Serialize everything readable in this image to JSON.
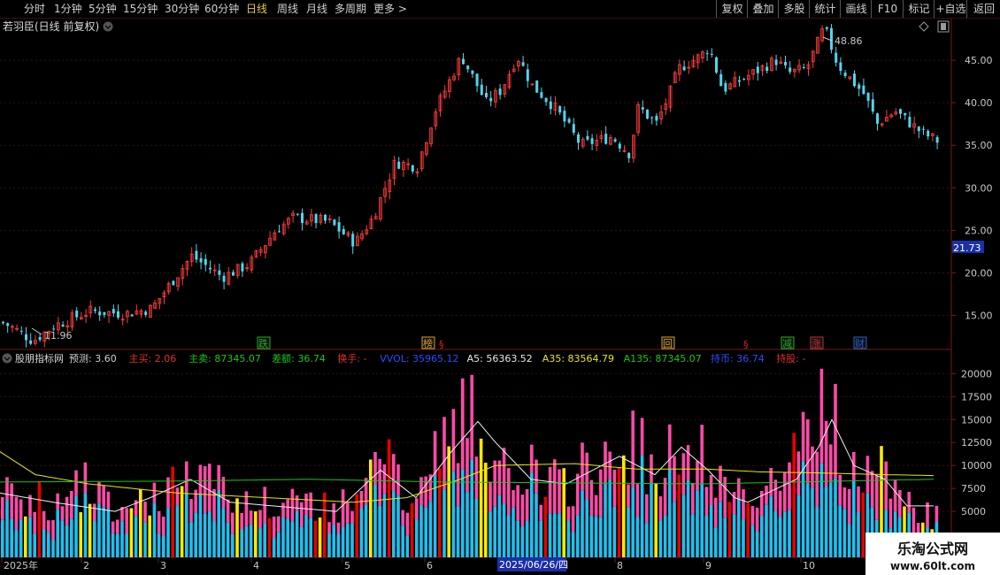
{
  "toolbar": {
    "periods": [
      "分时",
      "1分钟",
      "5分钟",
      "15分钟",
      "30分钟",
      "60分钟",
      "日线",
      "周线",
      "月线",
      "多周期",
      "更多 >"
    ],
    "active_period": "日线",
    "right_buttons": [
      "复权",
      "叠加",
      "多股",
      "统计",
      "画线",
      "F10",
      "标记",
      "+自选",
      "返回"
    ]
  },
  "main": {
    "title": "若羽臣(日线 前复权)",
    "high_label": "48.86",
    "low_label": "11.96",
    "current_price": "21.73",
    "y_ticks": [
      "45.00",
      "40.00",
      "35.00",
      "30.00",
      "25.00",
      "20.00",
      "15.00"
    ],
    "events": [
      {
        "label": "跌",
        "color": "#1db11d"
      },
      {
        "label": "榜",
        "color": "#d8a020"
      },
      {
        "label": "§",
        "color": "#e02020"
      },
      {
        "label": "回",
        "color": "#d8a020"
      },
      {
        "label": "§",
        "color": "#e02020"
      },
      {
        "label": "§",
        "color": "#e02020"
      },
      {
        "label": "减",
        "color": "#1db11d"
      },
      {
        "label": "涨",
        "color": "#c03030"
      },
      {
        "label": "财",
        "color": "#2060d0"
      }
    ]
  },
  "indicator": {
    "name": "股朋指标网",
    "fields": [
      {
        "text": "预测: 3.60",
        "color": "#d0d0d0"
      },
      {
        "text": "主买: 2.06",
        "color": "#e03030"
      },
      {
        "text": "主卖: 87345.07",
        "color": "#18c818"
      },
      {
        "text": "差额: 36.74",
        "color": "#18c818"
      },
      {
        "text": "换手: -",
        "color": "#e03030"
      },
      {
        "text": "VVOL: 35965.12",
        "color": "#2a4cff"
      },
      {
        "text": "A5: 56363.52",
        "color": "#e8e8e8"
      },
      {
        "text": "A35: 83564.79",
        "color": "#e8e800"
      },
      {
        "text": "A135: 87345.07",
        "color": "#18c818"
      },
      {
        "text": "持币: 36.74",
        "color": "#2a4cff"
      },
      {
        "text": "持股: -",
        "color": "#e03030"
      }
    ],
    "y_ticks": [
      "20000",
      "17500",
      "15000",
      "12500",
      "10000",
      "7500",
      "5000"
    ]
  },
  "xaxis": {
    "labels": [
      "2025年",
      "2",
      "3",
      "4",
      "5",
      "6",
      "7",
      "8",
      "9",
      "10"
    ],
    "cursor_date": "2025/06/26/四"
  },
  "watermark": {
    "line1": "乐淘公式网",
    "line2": "www.60lt.com"
  },
  "chart_data": {
    "type": "candlestick",
    "price_range": [
      11,
      50
    ],
    "volume_range": [
      0,
      21000
    ],
    "price_path": [
      [
        0,
        14.2
      ],
      [
        14,
        13.5
      ],
      [
        36,
        12.0
      ],
      [
        60,
        13.8
      ],
      [
        100,
        15.5
      ],
      [
        140,
        15.2
      ],
      [
        170,
        15.8
      ],
      [
        215,
        22.0
      ],
      [
        250,
        19.5
      ],
      [
        280,
        21.0
      ],
      [
        310,
        25.0
      ],
      [
        330,
        26.5
      ],
      [
        370,
        26.0
      ],
      [
        400,
        23.5
      ],
      [
        420,
        26.5
      ],
      [
        445,
        33.0
      ],
      [
        470,
        32.5
      ],
      [
        490,
        39.0
      ],
      [
        520,
        45.5
      ],
      [
        548,
        40.0
      ],
      [
        565,
        41.5
      ],
      [
        583,
        45.5
      ],
      [
        600,
        42.0
      ],
      [
        625,
        39.5
      ],
      [
        655,
        35.0
      ],
      [
        690,
        36.0
      ],
      [
        710,
        34.0
      ],
      [
        720,
        39.5
      ],
      [
        740,
        37.5
      ],
      [
        755,
        41.0
      ],
      [
        765,
        44.0
      ],
      [
        790,
        45.5
      ],
      [
        800,
        46.5
      ],
      [
        815,
        41.5
      ],
      [
        850,
        43.5
      ],
      [
        875,
        45.0
      ],
      [
        890,
        43.5
      ],
      [
        910,
        44.0
      ],
      [
        930,
        48.86
      ],
      [
        945,
        44.5
      ],
      [
        975,
        41.0
      ],
      [
        990,
        37.5
      ],
      [
        1010,
        39.0
      ],
      [
        1040,
        36.5
      ],
      [
        1058,
        35.5
      ]
    ],
    "volume_path": [
      [
        0,
        6500
      ],
      [
        70,
        6000
      ],
      [
        100,
        8000
      ],
      [
        130,
        5000
      ],
      [
        160,
        6000
      ],
      [
        190,
        7000
      ],
      [
        225,
        9000
      ],
      [
        260,
        6500
      ],
      [
        300,
        5500
      ],
      [
        340,
        6000
      ],
      [
        380,
        5000
      ],
      [
        410,
        7500
      ],
      [
        430,
        10500
      ],
      [
        460,
        7000
      ],
      [
        485,
        8500
      ],
      [
        500,
        13000
      ],
      [
        520,
        16000
      ],
      [
        540,
        14000
      ],
      [
        560,
        11000
      ],
      [
        580,
        10500
      ],
      [
        600,
        9000
      ],
      [
        630,
        7500
      ],
      [
        660,
        9500
      ],
      [
        690,
        10000
      ],
      [
        715,
        12500
      ],
      [
        740,
        9000
      ],
      [
        760,
        11500
      ],
      [
        790,
        10500
      ],
      [
        820,
        8000
      ],
      [
        845,
        6000
      ],
      [
        870,
        9500
      ],
      [
        900,
        10500
      ],
      [
        920,
        13500
      ],
      [
        930,
        20500
      ],
      [
        945,
        12000
      ],
      [
        965,
        10000
      ],
      [
        990,
        9000
      ],
      [
        1010,
        7500
      ],
      [
        1030,
        6000
      ],
      [
        1058,
        4000
      ]
    ],
    "a5_path": [
      [
        0,
        7000
      ],
      [
        60,
        6000
      ],
      [
        130,
        5000
      ],
      [
        170,
        6500
      ],
      [
        215,
        8500
      ],
      [
        260,
        6000
      ],
      [
        320,
        5500
      ],
      [
        380,
        5000
      ],
      [
        430,
        9500
      ],
      [
        470,
        6500
      ],
      [
        510,
        11500
      ],
      [
        540,
        14800
      ],
      [
        560,
        12500
      ],
      [
        600,
        8500
      ],
      [
        640,
        8000
      ],
      [
        700,
        11000
      ],
      [
        740,
        9000
      ],
      [
        770,
        12000
      ],
      [
        800,
        9500
      ],
      [
        830,
        6500
      ],
      [
        845,
        6000
      ],
      [
        900,
        8500
      ],
      [
        925,
        12000
      ],
      [
        940,
        15000
      ],
      [
        965,
        10000
      ],
      [
        1000,
        8500
      ],
      [
        1025,
        5600
      ],
      [
        1058,
        5600
      ]
    ],
    "a35_path": [
      [
        0,
        11500
      ],
      [
        40,
        9000
      ],
      [
        100,
        8000
      ],
      [
        200,
        7000
      ],
      [
        300,
        6500
      ],
      [
        400,
        6000
      ],
      [
        460,
        6500
      ],
      [
        520,
        8500
      ],
      [
        560,
        10000
      ],
      [
        650,
        10200
      ],
      [
        720,
        9600
      ],
      [
        800,
        9600
      ],
      [
        860,
        9300
      ],
      [
        920,
        9200
      ],
      [
        1000,
        9000
      ],
      [
        1058,
        8900
      ]
    ],
    "a135_path": [
      [
        0,
        8200
      ],
      [
        200,
        8300
      ],
      [
        350,
        8500
      ],
      [
        500,
        8200
      ],
      [
        650,
        8100
      ],
      [
        800,
        8000
      ],
      [
        900,
        8200
      ],
      [
        1000,
        8400
      ],
      [
        1058,
        8500
      ]
    ],
    "hist_color_pattern": [
      "#ff4aa8",
      "#1ec0f0",
      "#ffe800",
      "#e80000"
    ]
  }
}
